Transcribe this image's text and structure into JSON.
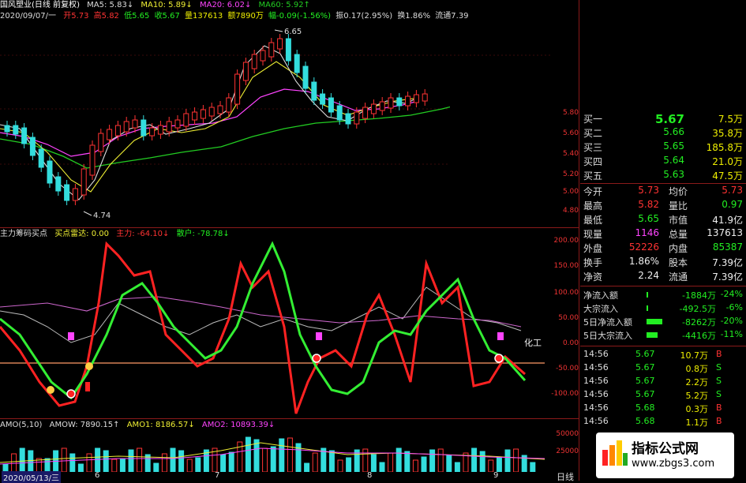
{
  "main_header": {
    "title": "国风塑业(日线 前复权)",
    "ma5": "MA5: 5.83↓",
    "ma10": "MA10: 5.89↓",
    "ma20": "MA20: 6.02↓",
    "ma60": "MA60: 5.92↑"
  },
  "info_line": {
    "date": "2020/09/07/一",
    "open": "开5.73",
    "high": "高5.82",
    "low": "低5.65",
    "close": "收5.67",
    "volume": "量137613",
    "amount": "额7890万",
    "change": "幅-0.09(-1.56%)",
    "amplitude": "振0.17(2.95%)",
    "turnover": "换1.86%",
    "float": "流通7.39"
  },
  "price_labels": {
    "high": "6.65",
    "low": "4.74"
  },
  "price_axis": [
    "5.80",
    "5.60",
    "5.40",
    "5.20",
    "5.00",
    "4.80"
  ],
  "indicator_header": {
    "name": "主力筹码买点",
    "buy_radar": "买点雷达: 0.00",
    "main_force": "主力: -64.10↓",
    "retail": "散户: -78.78↓"
  },
  "indicator_axis": [
    "200.00",
    "150.00",
    "100.00",
    "50.00",
    "0.00",
    "-50.00",
    "-100.00"
  ],
  "indicator_tag": "化工",
  "volume_header": {
    "amo": "AMO(5,10)",
    "amow": "AMOW: 7890.15↑",
    "amo1": "AMO1: 8186.57↓",
    "amo2": "AMO2: 10893.39↓"
  },
  "volume_axis": [
    "50000",
    "25000"
  ],
  "bottom_date": "2020/05/13/三",
  "bottom_tab": "日线",
  "month_labels": [
    "6",
    "7",
    "8",
    "9"
  ],
  "order_book": [
    {
      "label": "买一",
      "price": "5.67",
      "vol": "7.5万"
    },
    {
      "label": "买二",
      "price": "5.66",
      "vol": "35.8万"
    },
    {
      "label": "买三",
      "price": "5.65",
      "vol": "185.8万"
    },
    {
      "label": "买四",
      "price": "5.64",
      "vol": "21.0万"
    },
    {
      "label": "买五",
      "price": "5.63",
      "vol": "47.5万"
    }
  ],
  "stats": [
    {
      "l1": "今开",
      "v1": "5.73",
      "c1": "red",
      "l2": "均价",
      "v2": "5.73",
      "c2": "red"
    },
    {
      "l1": "最高",
      "v1": "5.82",
      "c1": "red",
      "l2": "量比",
      "v2": "0.97",
      "c2": "green"
    },
    {
      "l1": "最低",
      "v1": "5.65",
      "c1": "green",
      "l2": "市值",
      "v2": "41.9亿",
      "c2": "white"
    },
    {
      "l1": "现量",
      "v1": "1146",
      "c1": "mag",
      "l2": "总量",
      "v2": "137613",
      "c2": "white"
    },
    {
      "l1": "外盘",
      "v1": "52226",
      "c1": "red",
      "l2": "内盘",
      "v2": "85387",
      "c2": "green"
    },
    {
      "l1": "换手",
      "v1": "1.86%",
      "c1": "white",
      "l2": "股本",
      "v2": "7.39亿",
      "c2": "white"
    },
    {
      "l1": "净资",
      "v1": "2.24",
      "c1": "white",
      "l2": "流通",
      "v2": "7.39亿",
      "c2": "white"
    }
  ],
  "fund_flow": [
    {
      "label": "净流入额",
      "value": "-1884万",
      "pct": "-24%",
      "bar": 0.05
    },
    {
      "label": "大宗流入",
      "value": "-492.5万",
      "pct": "-6%",
      "bar": 0.02
    },
    {
      "label": "5日净流入额",
      "value": "-8262万",
      "pct": "-20%",
      "bar": 0.6
    },
    {
      "label": "5日大宗流入",
      "value": "-4416万",
      "pct": "-11%",
      "bar": 0.4
    }
  ],
  "ticks": [
    {
      "time": "14:56",
      "price": "5.67",
      "vol": "10.7万",
      "side": "B",
      "sc": "red"
    },
    {
      "time": "14:56",
      "price": "5.67",
      "vol": "0.8万",
      "side": "S",
      "sc": "green"
    },
    {
      "time": "14:56",
      "price": "5.67",
      "vol": "2.2万",
      "side": "S",
      "sc": "green"
    },
    {
      "time": "14:56",
      "price": "5.67",
      "vol": "5.2万",
      "side": "S",
      "sc": "green"
    },
    {
      "time": "14:56",
      "price": "5.68",
      "vol": "0.3万",
      "side": "B",
      "sc": "red"
    },
    {
      "time": "14:56",
      "price": "5.68",
      "vol": "1.1万",
      "side": "B",
      "sc": "red"
    }
  ],
  "watermark": {
    "title": "指标公式网",
    "url": "www.zbgs3.com"
  },
  "colors": {
    "up": "#ff3333",
    "down": "#33dddd",
    "main_line": "#ff2222",
    "retail_line": "#33ee33",
    "ma5": "#dddddd",
    "ma10": "#eeee33",
    "ma20": "#ff44ff",
    "ma60": "#22cc22"
  }
}
